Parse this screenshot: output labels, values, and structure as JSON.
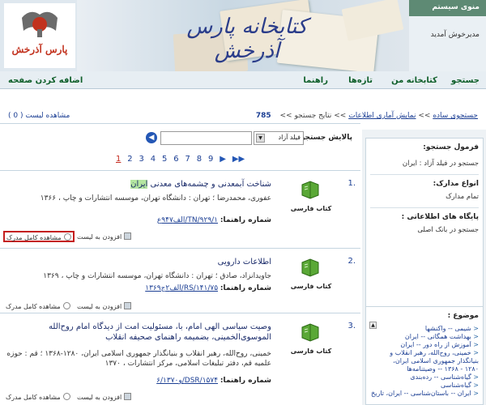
{
  "banner": {
    "title": "کتابخانه پارس آذرخش",
    "logo_text": "پارس آذرخش",
    "system_menu": "منوی سیستم",
    "welcome": "مدیرخوش آمدید"
  },
  "nav": {
    "search": "جستجو",
    "my_library": "کتابخانه من",
    "news": "تازه‌ها",
    "help": "راهنما",
    "add_home": "اضافه کردن صفحه"
  },
  "trail": {
    "simple_search": "جستجوی ساده",
    "stats": "نمایش آماری اطلاعات",
    "results": "نتایج جستجو",
    "count": "785",
    "sep": ">>"
  },
  "view_list": "مشاهده لیست ( 0 )",
  "filter": {
    "label": "پالایش جستجو",
    "field": "فیلد آزاد"
  },
  "pager": {
    "pages": [
      "1",
      "2",
      "3",
      "4",
      "5",
      "6",
      "7",
      "8",
      "9"
    ],
    "current": "1"
  },
  "results": [
    {
      "num": "1.",
      "type": "کتاب فارسی",
      "title_pre": "شناخت آبمعدنی و چشمه‌های معدنی ",
      "title_hl": "ایران",
      "desc": "عفوری، محمدرضا ؛ تهران : دانشگاه تهران، موسسه انتشارات و چاپ ، ۱۳۶۶",
      "shelf_label": "شماره راهنما:",
      "shelf_value": "TN/۹۲۹/۱/الف۹۴۷ع",
      "add_list": "افزودن به لیست",
      "marc": "مشاهده کامل مدرک"
    },
    {
      "num": "2.",
      "type": "کتاب فارسی",
      "title_pre": "اطلاعات دارویی",
      "title_hl": "",
      "desc": "جاویدانزاد، صادق ؛ تهران : دانشگاه تهران، موسسه انتشارات و چاپ ، ۱۳۶۹",
      "shelf_label": "شماره راهنما:",
      "shelf_value": "RS/۱۴۱/۷۵/الف۲ج۱۳۶۹",
      "add_list": "افزودن به لیست",
      "marc": "مشاهده کامل مدرک"
    },
    {
      "num": "3.",
      "type": "کتاب فارسی",
      "title_pre": "وصیت سیاسی الهی امام، با، مسئولیت امت از دیدگاه امام روح‌الله الموسوی‌الخمینی، بضمیمه راهنمای صحیفه انقلاب",
      "title_hl": "",
      "desc": "خمینی، روح‌الله، رهبر انقلاب و بنیانگذار جمهوری اسلامی ایران، ۱۲۸۰-۱۳۶۸ ؛ قم : حوزه علمیه قم، دفتر تبلیغات اسلامی، مرکز انتشارات ، ۱۳۷۰",
      "shelf_label": "شماره راهنما:",
      "shelf_value": "DSR/۱۵۷۴/و۶/۱۳۷۰",
      "add_list": "افزودن به لیست",
      "marc": "مشاهده کامل مدرک"
    }
  ],
  "sidebar": {
    "formula_title": "فرمول جستجو:",
    "formula_value": "جستجو در فیلد آزاد : ایران",
    "doctype_title": "انواع مدارک:",
    "doctype_value": "تمام مدارک",
    "db_title": "پایگاه های اطلاعاتی :",
    "db_value": "جستجو در بانک اصلی",
    "topics_title": "موضوع :",
    "topics": [
      "شیمی -- واکنشها",
      "بهداشت همگانی -- ایران",
      "آموزش از راه دور -- ایران",
      "خمینی، روح‌الله، رهبر انقلاب و",
      "بنیانگذار جمهوری اسلامی ایران،",
      "۱۲۸۰ - ۱۳۶۸ -- وصیتنامه‌ها",
      "گیاه‌شناسی -- رده‌بندی",
      "گیاه‌شناسی",
      "ایران -- باستان‌شناسی -- ایران، تاریخ"
    ]
  }
}
